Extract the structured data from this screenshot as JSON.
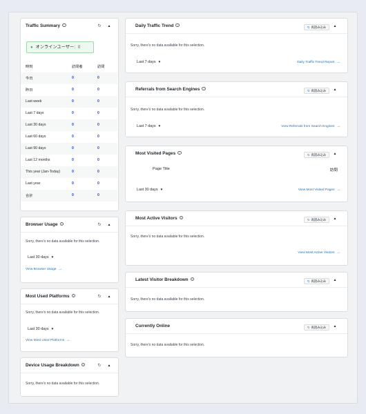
{
  "traffic_summary": {
    "title": "Traffic Summary",
    "online_label": "オンラインユーザー:",
    "online_count": "0",
    "columns": [
      "時刻",
      "訪問者",
      "訪問"
    ],
    "rows": [
      {
        "label": "今日",
        "visitors": "0",
        "visits": "0"
      },
      {
        "label": "昨日",
        "visitors": "0",
        "visits": "0"
      },
      {
        "label": "Last week",
        "visitors": "0",
        "visits": "0"
      },
      {
        "label": "Last 7 days",
        "visitors": "0",
        "visits": "0"
      },
      {
        "label": "Last 30 days",
        "visitors": "0",
        "visits": "0"
      },
      {
        "label": "Last 60 days",
        "visitors": "0",
        "visits": "0"
      },
      {
        "label": "Last 90 days",
        "visitors": "0",
        "visits": "0"
      },
      {
        "label": "Last 12 months",
        "visitors": "0",
        "visits": "0"
      },
      {
        "label": "This year (Jan-Today)",
        "visitors": "0",
        "visits": "0"
      },
      {
        "label": "Last year",
        "visitors": "0",
        "visits": "0"
      },
      {
        "label": "合計",
        "visitors": "0",
        "visits": "0"
      }
    ]
  },
  "common": {
    "no_data": "Sorry, there's no data available for this selection.",
    "reload_label": "再読み込み",
    "info_glyph": "i",
    "reload_glyph": "↻",
    "caret_glyph": "▲",
    "dropdown_glyph": "▼",
    "link_arrow": "→"
  },
  "browser_usage": {
    "title": "Browser Usage",
    "period": "Last 30 days",
    "link": "View Browser Usage"
  },
  "most_used_platforms": {
    "title": "Most Used Platforms",
    "period": "Last 30 days",
    "link": "View Most Used Platforms"
  },
  "device_usage": {
    "title": "Device Usage Breakdown"
  },
  "daily_traffic": {
    "title": "Daily Traffic Trend",
    "period": "Last 7 days",
    "link": "Daily Traffic Trend Report"
  },
  "referrals": {
    "title": "Referrals from Search Engines",
    "period": "Last 7 days",
    "link": "View Referrals from Search Engines"
  },
  "most_visited": {
    "title": "Most Visited Pages",
    "col_title": "Page Title",
    "col_visits": "訪問",
    "period": "Last 30 days",
    "link": "View Most Visited Pages"
  },
  "most_active": {
    "title": "Most Active Visitors",
    "link": "View Most Active Visitors"
  },
  "latest_visitor": {
    "title": "Latest Visitor Breakdown"
  },
  "currently_online": {
    "title": "Currently Online"
  }
}
